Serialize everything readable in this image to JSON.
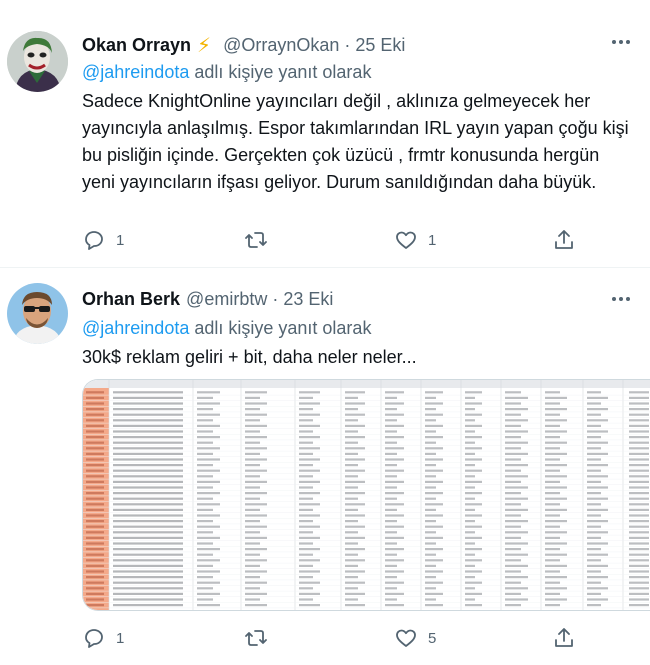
{
  "tweets": [
    {
      "name": "Okan Orrayn",
      "badge": "lightning-bolt",
      "handle": "@OrraynOkan",
      "separator": "·",
      "date": "25 Eki",
      "reply_mention": "@jahreindota",
      "reply_suffix": "adlı kişiye yanıt olarak",
      "text": "Sadece KnightOnline yayıncıları değil , aklınıza gelmeyecek her yayıncıyla anlaşılmış. Espor takımlarından IRL yayın yapan çoğu kişi bu pisliğin içinde. Gerçekten çok üzücü , frmtr konusunda hergün yeni yayıncıların ifşası geliyor. Durum sanıldığından daha büyük.",
      "reply_count": "1",
      "retweet_count": "",
      "like_count": "1"
    },
    {
      "name": "Orhan Berk",
      "handle": "@emirbtw",
      "separator": "·",
      "date": "23 Eki",
      "reply_mention": "@jahreindota",
      "reply_suffix": "adlı kişiye yanıt olarak",
      "text": "30k$ reklam geliri + bit, daha neler neler...",
      "reply_count": "1",
      "retweet_count": "",
      "like_count": "5"
    }
  ],
  "colors": {
    "accent": "#1d9bf0",
    "secondary_text": "#536471",
    "bolt": "#f4b400",
    "spreadsheet_highlight": "#f4a98a"
  },
  "icons": [
    "more-icon",
    "reply-icon",
    "retweet-icon",
    "like-icon",
    "share-icon",
    "lightning-bolt-icon"
  ]
}
